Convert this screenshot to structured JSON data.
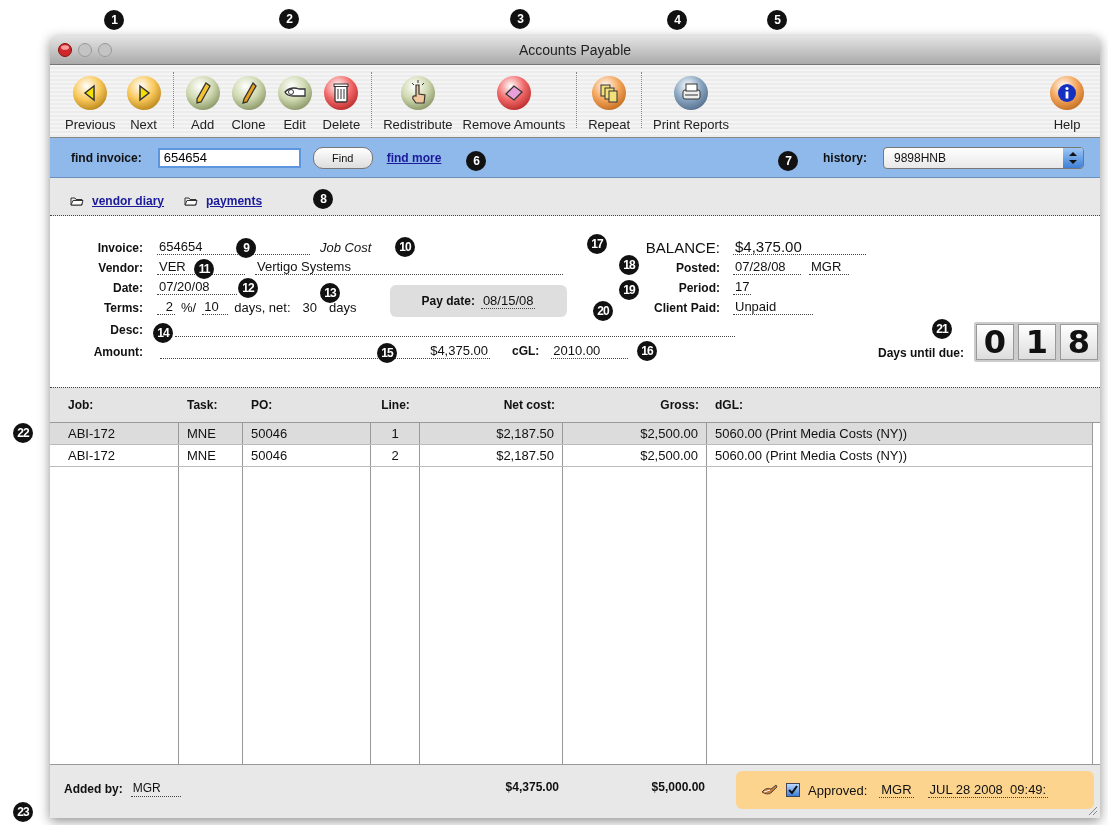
{
  "callouts": [
    "1",
    "2",
    "3",
    "4",
    "5",
    "6",
    "7",
    "8",
    "9",
    "10",
    "11",
    "12",
    "13",
    "14",
    "15",
    "16",
    "17",
    "18",
    "19",
    "20",
    "21",
    "22",
    "23"
  ],
  "window": {
    "title": "Accounts Payable"
  },
  "toolbar": [
    {
      "label": "Previous",
      "kind": "previous",
      "separator_after": false
    },
    {
      "label": "Next",
      "kind": "next",
      "separator_after": true
    },
    {
      "label": "Add",
      "kind": "add",
      "separator_after": false
    },
    {
      "label": "Clone",
      "kind": "clone",
      "separator_after": false
    },
    {
      "label": "Edit",
      "kind": "edit",
      "separator_after": false
    },
    {
      "label": "Delete",
      "kind": "delete",
      "separator_after": true
    },
    {
      "label": "Redistribute",
      "kind": "redistribute",
      "separator_after": false
    },
    {
      "label": "Remove Amounts",
      "kind": "remove",
      "separator_after": true
    },
    {
      "label": "Repeat",
      "kind": "repeat",
      "separator_after": true
    },
    {
      "label": "Print Reports",
      "kind": "print",
      "separator_after": false
    },
    {
      "label": "Help",
      "kind": "help",
      "separator_after": false
    }
  ],
  "find_bar": {
    "label": "find invoice:",
    "value": "654654",
    "button": "Find",
    "link": "find more",
    "history_label": "history:",
    "history_value": "9898HNB"
  },
  "links": [
    {
      "label": "vendor diary"
    },
    {
      "label": "payments"
    }
  ],
  "form": {
    "invoice": {
      "label": "Invoice:",
      "value": "654654",
      "type": "Job Cost"
    },
    "vendor": {
      "label": "Vendor:",
      "code": "VER",
      "name": "Vertigo Systems"
    },
    "date": {
      "label": "Date:",
      "value": "07/20/08"
    },
    "terms": {
      "label": "Terms:",
      "discount": "2",
      "discount_unit": "%/",
      "discount_days": "10",
      "net_text": "days, net:",
      "net_days": "30",
      "days_text": "days"
    },
    "pay_date": {
      "label": "Pay date:",
      "value": "08/15/08"
    },
    "desc": {
      "label": "Desc:"
    },
    "amount": {
      "label": "Amount:",
      "value": "$4,375.00"
    },
    "cgl": {
      "label": "cGL:",
      "value": "2010.00"
    },
    "balance": {
      "label": "BALANCE:",
      "value": "$4,375.00"
    },
    "posted": {
      "label": "Posted:",
      "date": "07/28/08",
      "user": "MGR"
    },
    "period": {
      "label": "Period:",
      "value": "17"
    },
    "client_paid": {
      "label": "Client Paid:",
      "value": "Unpaid"
    },
    "days_until_due": {
      "label": "Days until due:",
      "digits": [
        "0",
        "1",
        "8"
      ]
    }
  },
  "table": {
    "columns": [
      {
        "label": "Job:"
      },
      {
        "label": "Task:"
      },
      {
        "label": "PO:"
      },
      {
        "label": "Line:"
      },
      {
        "label": "Net cost:"
      },
      {
        "label": "Gross:"
      },
      {
        "label": "dGL:"
      }
    ],
    "rows": [
      {
        "selected": true,
        "cells": [
          "ABI-172",
          "MNE",
          "50046",
          "1",
          "$2,187.50",
          "$2,500.00",
          "5060.00 (Print Media Costs (NY))"
        ]
      },
      {
        "selected": false,
        "cells": [
          "ABI-172",
          "MNE",
          "50046",
          "2",
          "$2,187.50",
          "$2,500.00",
          "5060.00 (Print Media Costs (NY))"
        ]
      }
    ]
  },
  "footer": {
    "added_by_label": "Added by:",
    "added_by": "MGR",
    "totals": [
      "$4,375.00",
      "$5,000.00"
    ],
    "approval": {
      "checked": true,
      "label": "Approved:",
      "user": "MGR",
      "timestamp": "JUL 28 2008  09:49:"
    }
  }
}
